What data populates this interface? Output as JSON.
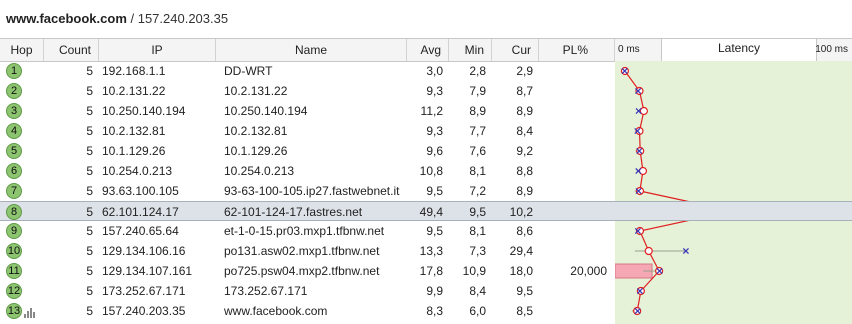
{
  "title": {
    "host": "www.facebook.com",
    "rest": " / 157.240.203.35"
  },
  "columns": {
    "hop": "Hop",
    "count": "Count",
    "ip": "IP",
    "name": "Name",
    "avg": "Avg",
    "min": "Min",
    "cur": "Cur",
    "pl": "PL%",
    "latency": "Latency",
    "lat_min": "0 ms",
    "lat_max": "100 ms"
  },
  "selected_hop": 8,
  "colors": {
    "graph_bg": "#e6f2d8",
    "line": "#e02020",
    "marker": "#3a3ab8",
    "loss_bar": "#f5a8b4",
    "hop_badge": "#8cc470"
  },
  "hops": [
    {
      "hop": "1",
      "count": "5",
      "ip": "192.168.1.1",
      "name": "DD-WRT",
      "avg": "3,0",
      "min": "2,8",
      "cur": "2,9",
      "pl": ""
    },
    {
      "hop": "2",
      "count": "5",
      "ip": "10.2.131.22",
      "name": "10.2.131.22",
      "avg": "9,3",
      "min": "7,9",
      "cur": "8,7",
      "pl": ""
    },
    {
      "hop": "3",
      "count": "5",
      "ip": "10.250.140.194",
      "name": "10.250.140.194",
      "avg": "11,2",
      "min": "8,9",
      "cur": "8,9",
      "pl": ""
    },
    {
      "hop": "4",
      "count": "5",
      "ip": "10.2.132.81",
      "name": "10.2.132.81",
      "avg": "9,3",
      "min": "7,7",
      "cur": "8,4",
      "pl": ""
    },
    {
      "hop": "5",
      "count": "5",
      "ip": "10.1.129.26",
      "name": "10.1.129.26",
      "avg": "9,6",
      "min": "7,6",
      "cur": "9,2",
      "pl": ""
    },
    {
      "hop": "6",
      "count": "5",
      "ip": "10.254.0.213",
      "name": "10.254.0.213",
      "avg": "10,8",
      "min": "8,1",
      "cur": "8,8",
      "pl": ""
    },
    {
      "hop": "7",
      "count": "5",
      "ip": "93.63.100.105",
      "name": "93-63-100-105.ip27.fastwebnet.it",
      "avg": "9,5",
      "min": "7,2",
      "cur": "8,9",
      "pl": ""
    },
    {
      "hop": "8",
      "count": "5",
      "ip": "62.101.124.17",
      "name": "62-101-124-17.fastres.net",
      "avg": "49,4",
      "min": "9,5",
      "cur": "10,2",
      "pl": ""
    },
    {
      "hop": "9",
      "count": "5",
      "ip": "157.240.65.64",
      "name": "et-1-0-15.pr03.mxp1.tfbnw.net",
      "avg": "9,5",
      "min": "8,1",
      "cur": "8,6",
      "pl": ""
    },
    {
      "hop": "10",
      "count": "5",
      "ip": "129.134.106.16",
      "name": "po131.asw02.mxp1.tfbnw.net",
      "avg": "13,3",
      "min": "7,3",
      "cur": "29,4",
      "pl": ""
    },
    {
      "hop": "11",
      "count": "5",
      "ip": "129.134.107.161",
      "name": "po725.psw04.mxp2.tfbnw.net",
      "avg": "17,8",
      "min": "10,9",
      "cur": "18,0",
      "pl": "20,000"
    },
    {
      "hop": "12",
      "count": "5",
      "ip": "173.252.67.171",
      "name": "173.252.67.171",
      "avg": "9,9",
      "min": "8,4",
      "cur": "9,5",
      "pl": ""
    },
    {
      "hop": "13",
      "count": "5",
      "ip": "157.240.203.35",
      "name": "www.facebook.com",
      "avg": "8,3",
      "min": "6,0",
      "cur": "8,5",
      "pl": ""
    }
  ]
}
